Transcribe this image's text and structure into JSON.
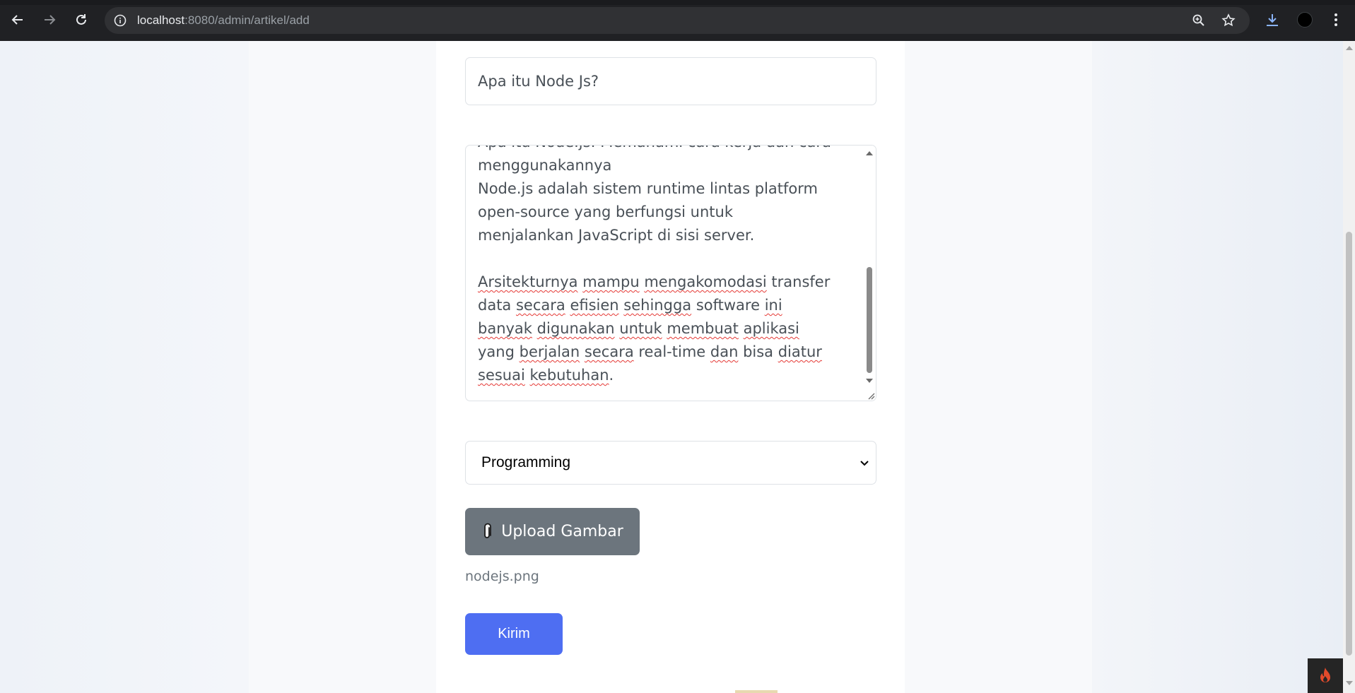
{
  "browser": {
    "url_host": "localhost",
    "url_path": ":8080/admin/artikel/add",
    "icons": {
      "back": "back-arrow-icon",
      "forward": "forward-arrow-icon",
      "reload": "reload-icon",
      "site_info": "info-icon",
      "zoom": "zoom-icon",
      "bookmark": "star-icon",
      "download": "download-icon",
      "profile": "profile-avatar",
      "menu": "kebab-menu-icon"
    }
  },
  "form": {
    "title_value": "Apa itu Node Js?",
    "content": {
      "line1": "Apa itu Node.js: Memahami cara kerja dan cara",
      "line2": "menggunakannya",
      "line3": "Node.js adalah sistem runtime lintas platform",
      "line4": "open-source yang berfungsi untuk",
      "line5": "menjalankan JavaScript di sisi server.",
      "p2": {
        "w1": "Arsitekturnya",
        "w2": "mampu",
        "w3": "mengakomodasi",
        "t1": " transfer",
        "t2": "data ",
        "w4": "secara",
        "w5": "efisien",
        "w6": "sehingga",
        "t3": " software ",
        "w7": "ini",
        "w8": "banyak",
        "w9": "digunakan",
        "w10": "untuk",
        "w11": "membuat",
        "w12": "aplikasi",
        "t4": "yang ",
        "w13": "berjalan",
        "w14": "secara",
        "t5": " real-time ",
        "w15": "dan",
        "t6": " bisa ",
        "w16": "diatur",
        "w17": "sesuai",
        "w18": "kebutuhan",
        "t7": "."
      }
    },
    "category_selected": "Programming",
    "upload_label": "Upload Gambar",
    "upload_icon": "paperclip-icon",
    "filename": "nodejs.png",
    "submit_label": "Kirim"
  },
  "colors": {
    "upload_button": "#6c757d",
    "submit_button": "#4e6ef2",
    "text": "#495057"
  }
}
